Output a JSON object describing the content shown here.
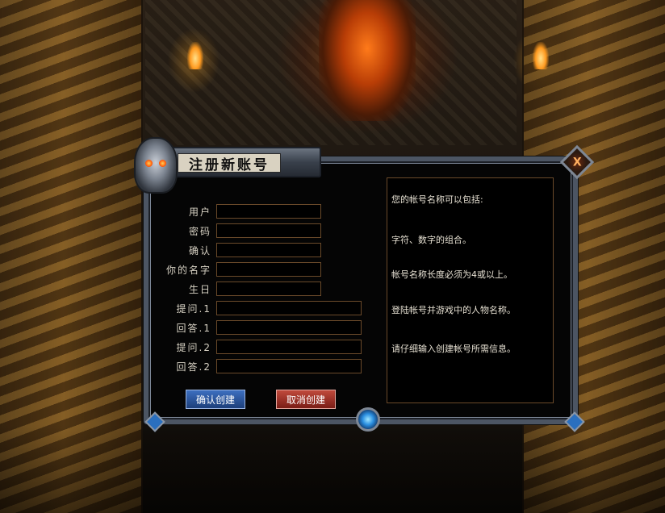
{
  "dialog": {
    "title": "注册新账号",
    "close_label": "X"
  },
  "form": {
    "fields": [
      {
        "label": "用户",
        "value": ""
      },
      {
        "label": "密码",
        "value": ""
      },
      {
        "label": "确认",
        "value": ""
      },
      {
        "label": "你的名字",
        "value": ""
      },
      {
        "label": "生日",
        "value": ""
      },
      {
        "label": "提问.1",
        "value": ""
      },
      {
        "label": "回答.1",
        "value": ""
      },
      {
        "label": "提问.2",
        "value": ""
      },
      {
        "label": "回答.2",
        "value": ""
      }
    ]
  },
  "buttons": {
    "confirm_label": "确认创建",
    "cancel_label": "取消创建"
  },
  "info": {
    "lines": [
      "您的帐号名称可以包括:",
      "字符、数字的组合。",
      "帐号名称长度必须为4或以上。",
      "登陆帐号并游戏中的人物名称。",
      "请仔细输入创建帐号所需信息。"
    ]
  },
  "colors": {
    "confirm_button": "#2a5aa8",
    "cancel_button": "#a83a2e",
    "field_border": "#6b4a2a"
  }
}
